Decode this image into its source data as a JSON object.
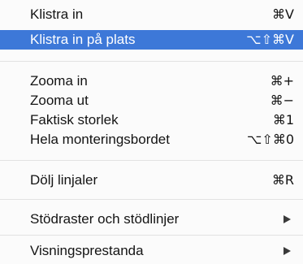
{
  "menu": {
    "items": [
      {
        "label": "Klistra in",
        "shortcut": "⌘V"
      },
      {
        "label": "Klistra in på plats",
        "shortcut": "⌥⇧⌘V",
        "highlighted": true
      },
      {
        "label": "Zooma in",
        "shortcut": "⌘+"
      },
      {
        "label": "Zooma ut",
        "shortcut": "⌘−"
      },
      {
        "label": "Faktisk storlek",
        "shortcut": "⌘1"
      },
      {
        "label": "Hela monteringsbordet",
        "shortcut": "⌥⇧⌘0"
      },
      {
        "label": "Dölj linjaler",
        "shortcut": "⌘R"
      },
      {
        "label": "Stödraster och stödlinjer",
        "icon": "submenu-arrow-icon"
      },
      {
        "label": "Visningsprestanda",
        "icon": "submenu-arrow-icon"
      }
    ],
    "highlight_color": "#3d78d8"
  }
}
